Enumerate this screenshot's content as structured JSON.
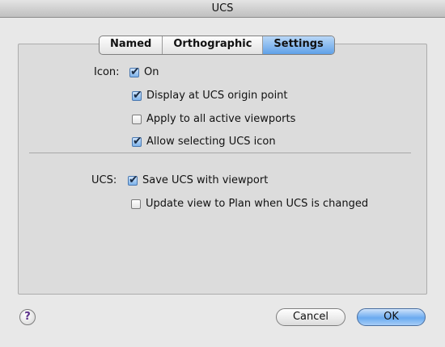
{
  "window": {
    "title": "UCS"
  },
  "tabs": [
    {
      "label": "Named",
      "active": false
    },
    {
      "label": "Orthographic",
      "active": false
    },
    {
      "label": "Settings",
      "active": true
    }
  ],
  "icon_section": {
    "label": "Icon:",
    "options": [
      {
        "label": "On",
        "checked": true
      },
      {
        "label": "Display at UCS origin point",
        "checked": true
      },
      {
        "label": "Apply to all active viewports",
        "checked": false
      },
      {
        "label": "Allow selecting UCS icon",
        "checked": true
      }
    ]
  },
  "ucs_section": {
    "label": "UCS:",
    "options": [
      {
        "label": "Save UCS with viewport",
        "checked": true
      },
      {
        "label": "Update view to Plan when UCS is changed",
        "checked": false
      }
    ]
  },
  "help": {
    "glyph": "?"
  },
  "buttons": {
    "cancel": "Cancel",
    "ok": "OK"
  },
  "colors": {
    "default_button": "#6aaaf0",
    "active_tab": "#5fa1e8",
    "help_glyph": "#5a2e8a"
  }
}
